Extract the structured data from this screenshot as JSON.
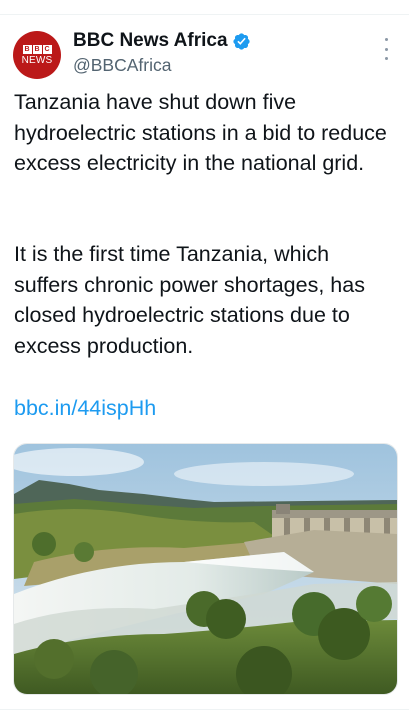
{
  "tweet": {
    "author": {
      "avatar_text": "NEWS",
      "avatar_letters": [
        "B",
        "B",
        "C"
      ],
      "name": "BBC News Africa",
      "handle": "@BBCAfrica",
      "verified_icon": "verified-badge-icon"
    },
    "more_icon": "more-options-icon",
    "paragraphs": [
      "Tanzania have shut down five hydroelectric stations in a bid to reduce excess electricity in the national grid.",
      "It is the first time Tanzania, which suffers chronic power shortages, has closed hydroelectric stations due to excess production."
    ],
    "link": "bbc.in/44ispHh"
  },
  "colors": {
    "brand_red": "#bb1919",
    "link_blue": "#1d9bf0",
    "verified_blue": "#1d9bf0",
    "handle_gray": "#536471"
  }
}
